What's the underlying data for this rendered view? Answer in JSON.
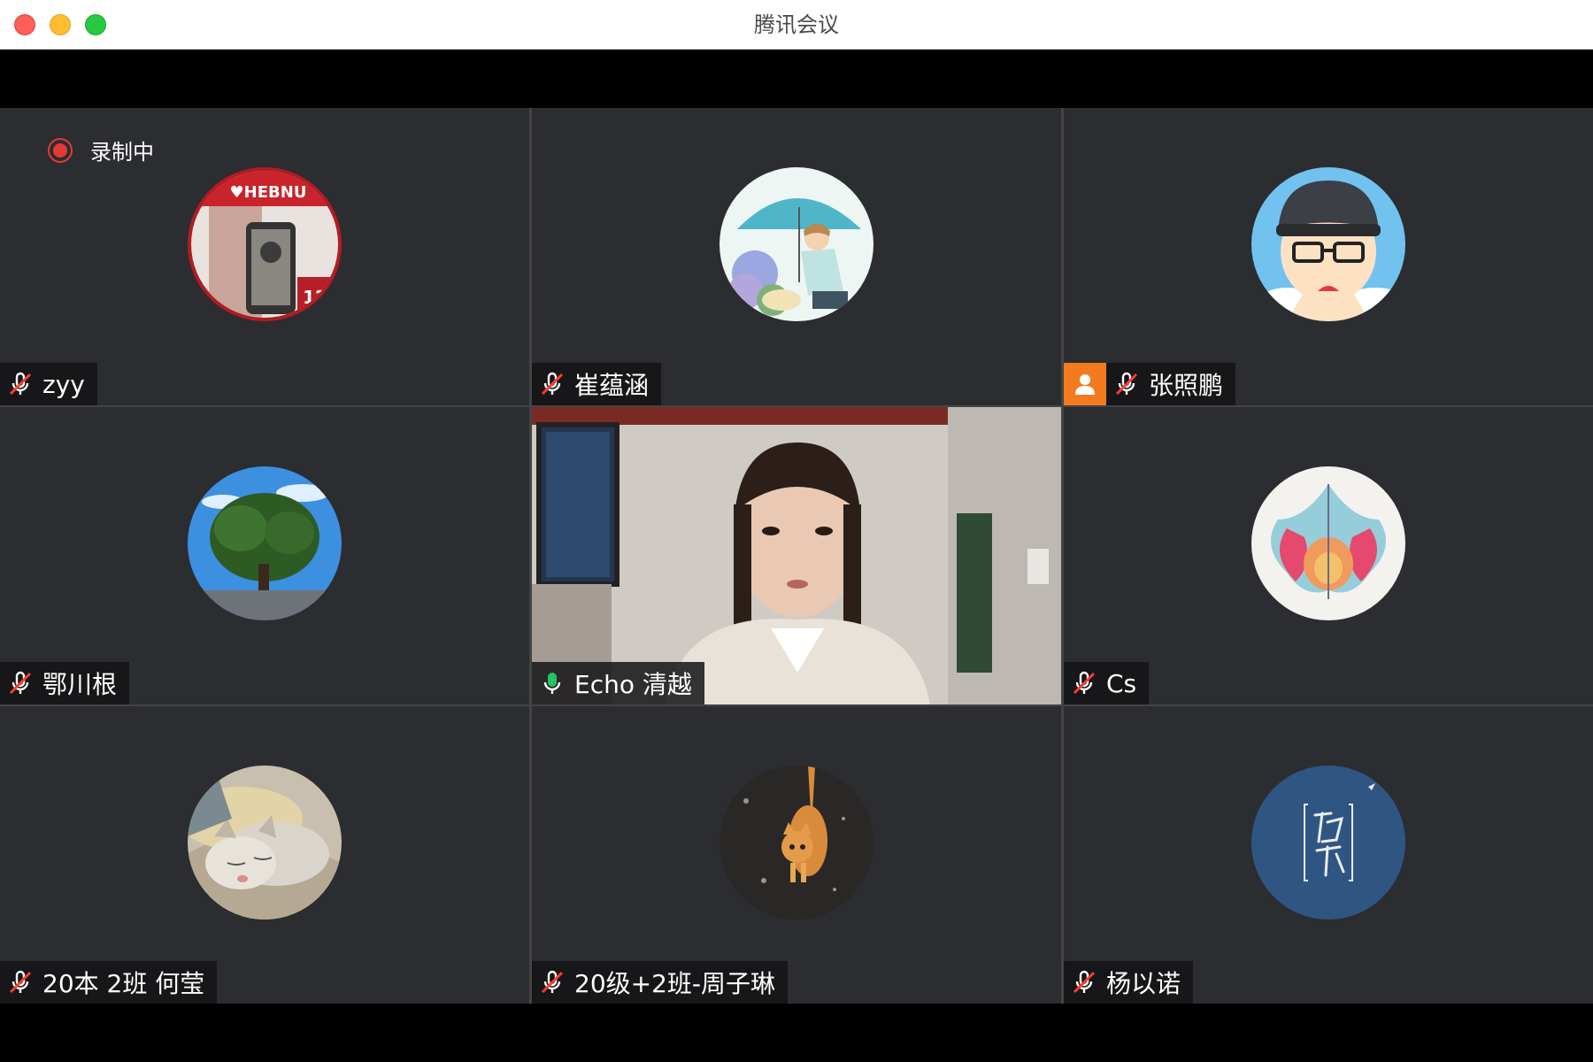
{
  "window": {
    "title": "腾讯会议"
  },
  "recording": {
    "label": "录制中"
  },
  "colors": {
    "active_speaker": "#22c55e",
    "host_badge": "#f47a1f",
    "recording": "#e53935",
    "tile_bg": "#2b2d31"
  },
  "participants": [
    {
      "name": "zyy",
      "mic": "muted-mic-icon",
      "host": false
    },
    {
      "name": "崔蕴涵",
      "mic": "muted-mic-icon",
      "host": false
    },
    {
      "name": "张照鹏",
      "mic": "muted-mic-icon",
      "host": true
    },
    {
      "name": "鄂川根",
      "mic": "muted-mic-icon",
      "host": false
    },
    {
      "name": "Echo 清越",
      "mic": "active-mic-icon",
      "host": false,
      "video_on": true,
      "active_speaker": true
    },
    {
      "name": "Cs",
      "mic": "muted-mic-icon",
      "host": false
    },
    {
      "name": "20本 2班 何莹",
      "mic": "muted-mic-icon",
      "host": false
    },
    {
      "name": "20级+2班-周子琳",
      "mic": "muted-mic-icon",
      "host": false
    },
    {
      "name": "杨以诺",
      "mic": "muted-mic-icon",
      "host": false
    }
  ]
}
